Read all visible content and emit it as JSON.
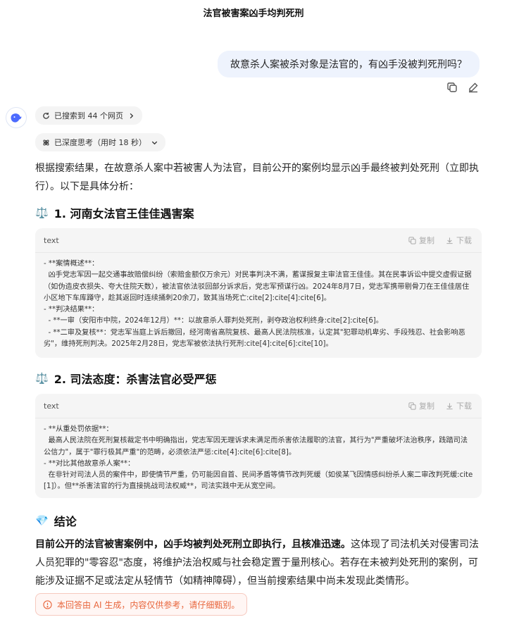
{
  "header": {
    "title": "法官被害案凶手均判死刑"
  },
  "user_message": {
    "text": "故意杀人案被杀对象是法官的，有凶手没被判死刑吗？"
  },
  "message_actions": {
    "copy_icon": "copy-icon",
    "edit_icon": "edit-icon"
  },
  "search_pill": {
    "label": "已搜索到 44 个网页"
  },
  "think_pill": {
    "label": "已深度思考（用时 18 秒）"
  },
  "intro": "根据搜索结果，在故意杀人案中若被害人为法官，目前公开的案例均显示凶手最终被判处死刑（立即执行）。以下是具体分析：",
  "section1": {
    "emoji": "⚖️",
    "title": "1. 河南女法官王佳佳遇害案"
  },
  "code1": {
    "lang": "text",
    "copy_label": "复制",
    "download_label": "下载",
    "content": "- **案情概述**：\n  凶手党志军因一起交通事故赔偿纠纷（索赔金额仅万余元）对民事判决不满，蓄谋报复主审法官王佳佳。其在民事诉讼中提交虚假证据（如伪造皮衣损失、夸大住院天数），被法官依法驳回部分诉求后，党志军预谋行凶。2024年8月7日，党志军携带剔骨刀在王佳佳居住小区地下车库蹲守，趁其返回时连续捅刺20余刀，致其当场死亡:cite[2]:cite[4]:cite[6]。\n- **判决结果**：\n  - **一审（安阳市中院，2024年12月）**：以故意杀人罪判处死刑，剥夺政治权利终身:cite[2]:cite[6]。\n  - **二审及复核**：党志军当庭上诉后撤回，经河南省高院复核、最高人民法院核准，认定其\"犯罪动机卑劣、手段残忍、社会影响恶劣\"，维持死刑判决。2025年2月28日，党志军被依法执行死刑:cite[4]:cite[6]:cite[10]。"
  },
  "section2": {
    "emoji": "⚖️",
    "title": "2. 司法态度：杀害法官必受严惩"
  },
  "code2": {
    "lang": "text",
    "copy_label": "复制",
    "download_label": "下载",
    "content": "- **从重处罚依据**：\n  最高人民法院在死刑复核裁定书中明确指出，党志军因无理诉求未满足而杀害依法履职的法官，其行为\"严重破坏法治秩序，践踏司法公信力\"，属于\"罪行极其严重\"的范畴，必须依法严惩:cite[4]:cite[6]:cite[8]。\n- **对比其他故意杀人案**：\n  在非针对司法人员的案件中，即使情节严重，仍可能因自首、民间矛盾等情节改判死缓（如侯某飞因情感纠纷杀人案二审改判死缓:cite[1]）。但**杀害法官的行为直接挑战司法权威**，司法实践中无从宽空间。"
  },
  "section3": {
    "emoji": "💎",
    "title": "结论"
  },
  "conclusion": {
    "bold": "目前公开的法官被害案例中，凶手均被判处死刑立即执行，且核准迅速。",
    "rest": "这体现了司法机关对侵害司法人员犯罪的\"零容忍\"态度，将维护法治权威与社会稳定置于量刑核心。若存在未被判处死刑的案例，可能涉及证据不足或法定从轻情节（如精神障碍），但当前搜索结果中尚未发现此类情形。"
  },
  "disclaimer": {
    "text": "本回答由 AI 生成，内容仅供参考，请仔细甄别。"
  }
}
